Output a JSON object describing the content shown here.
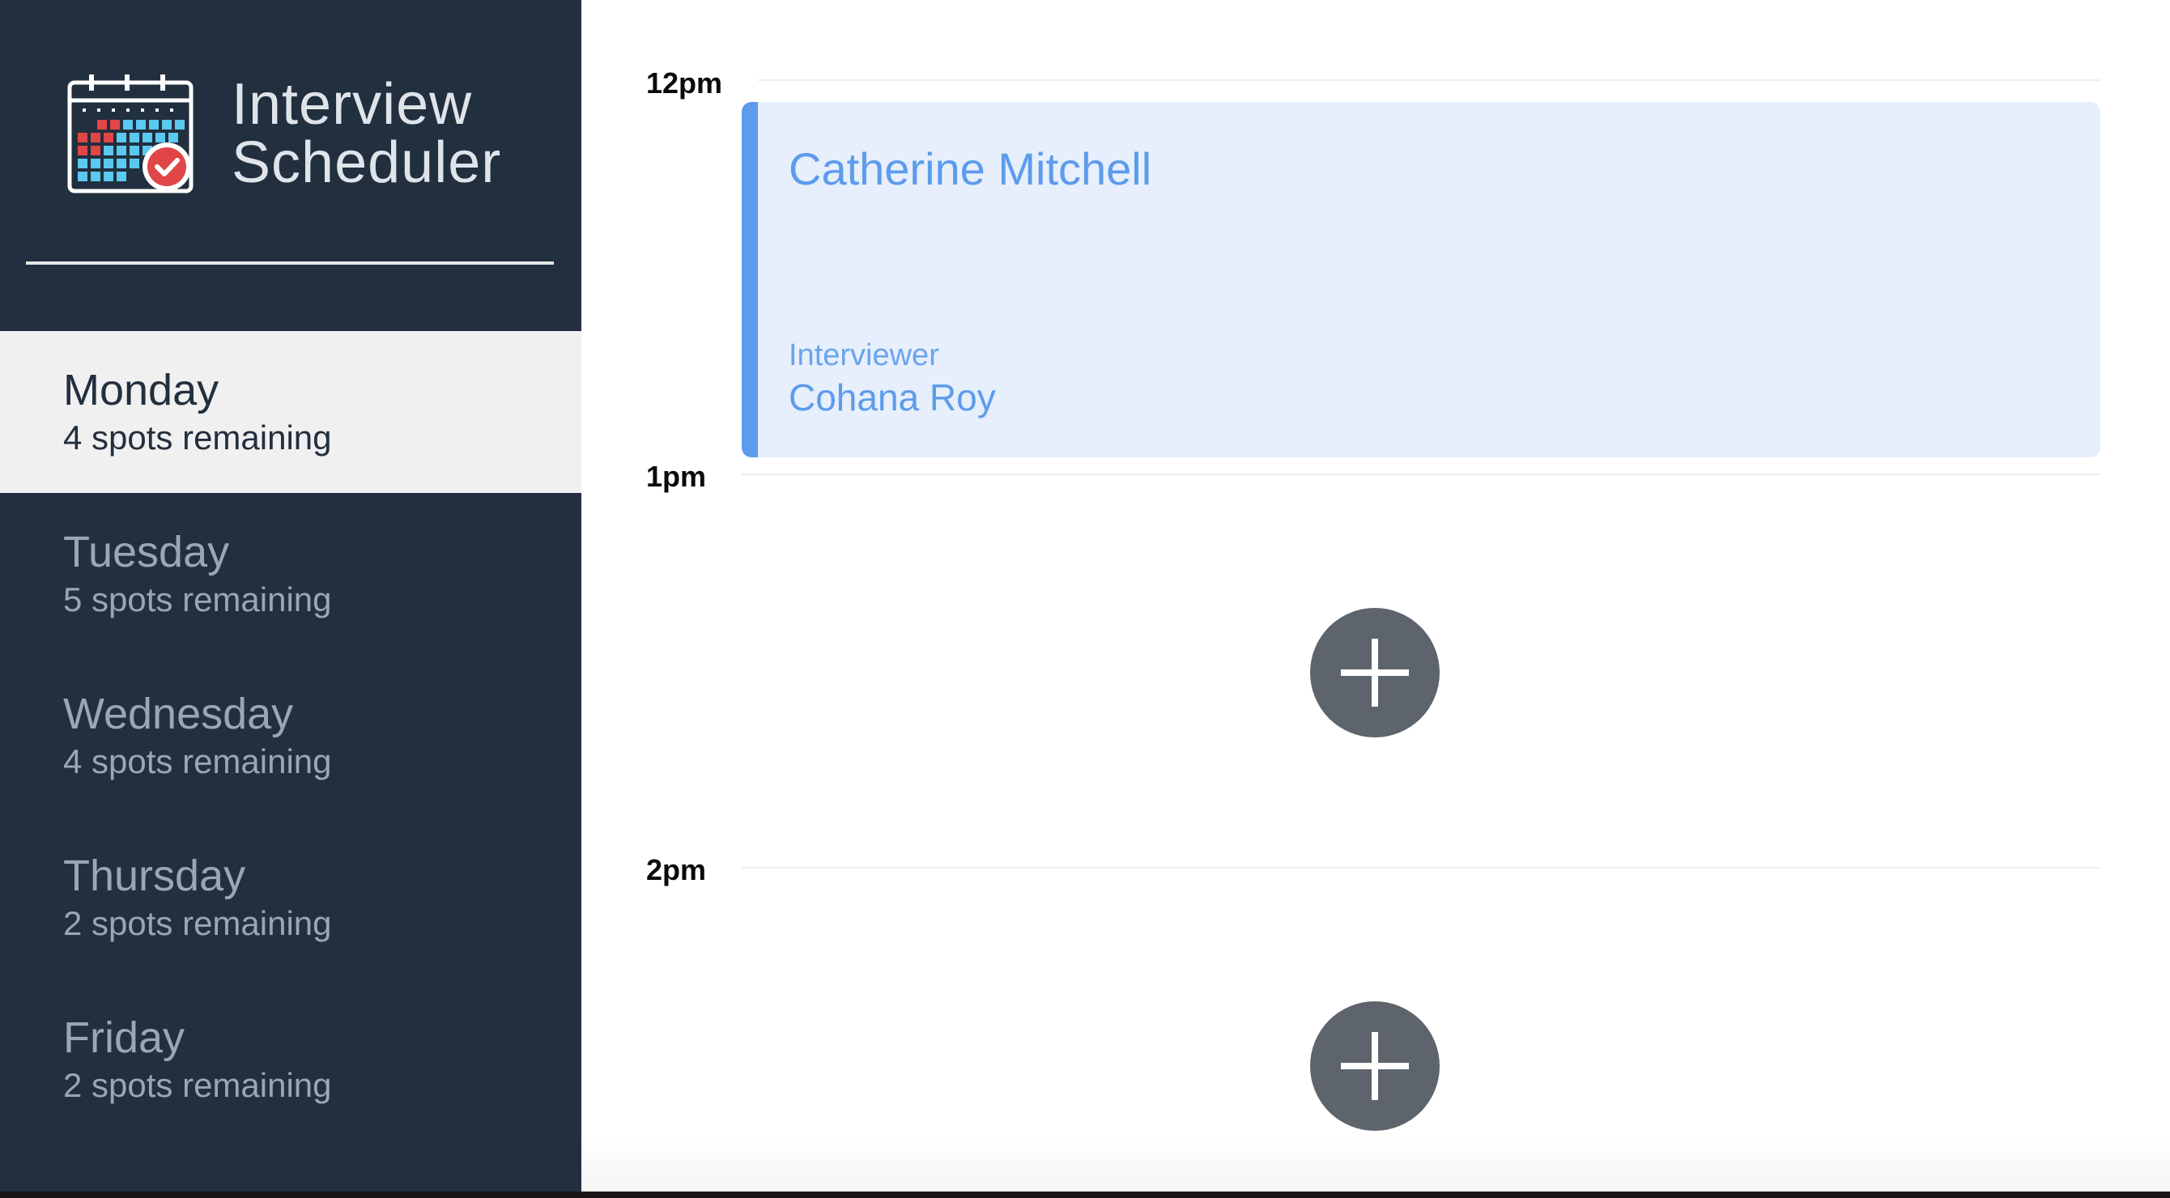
{
  "app": {
    "title_line1": "Interview",
    "title_line2": "Scheduler"
  },
  "days": [
    {
      "name": "Monday",
      "spots": "4 spots remaining",
      "selected": true
    },
    {
      "name": "Tuesday",
      "spots": "5 spots remaining",
      "selected": false
    },
    {
      "name": "Wednesday",
      "spots": "4 spots remaining",
      "selected": false
    },
    {
      "name": "Thursday",
      "spots": "2 spots remaining",
      "selected": false
    },
    {
      "name": "Friday",
      "spots": "2 spots remaining",
      "selected": false
    }
  ],
  "schedule": {
    "hours": [
      "12pm",
      "1pm",
      "2pm"
    ],
    "appointment": {
      "student": "Catherine Mitchell",
      "interviewer_label": "Interviewer",
      "interviewer": "Cohana Roy"
    }
  },
  "colors": {
    "sidebar": "#222f3e",
    "appointment_accent": "#5d9bec",
    "add_button": "#5e646b"
  },
  "icons": {
    "logo": "calendar-check-icon",
    "add": "plus-icon"
  }
}
